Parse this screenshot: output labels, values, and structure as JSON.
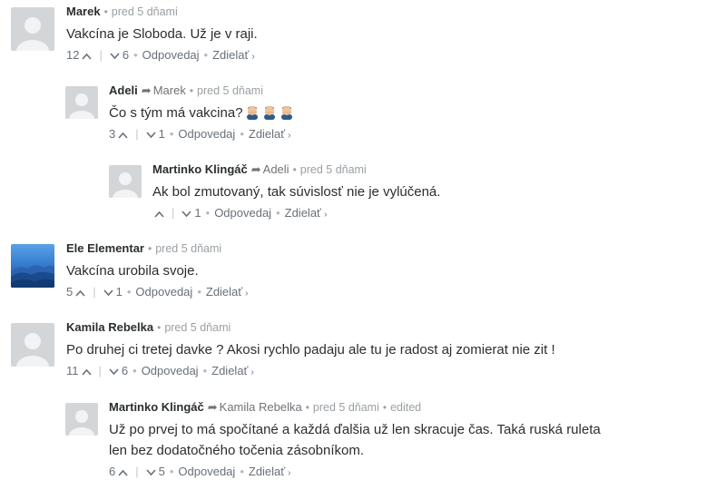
{
  "comments": [
    {
      "author": "Marek",
      "reply_to": "",
      "time": "pred 5 dňami",
      "edited": "",
      "text": "Vakcína je Sloboda. Už je v raji.",
      "upvotes": "12",
      "downvotes": "6",
      "reply_label": "Odpovedaj",
      "share_label": "Zdielať",
      "avatar": "default-avatar"
    },
    {
      "author": "Adeli",
      "reply_to": "Marek",
      "time": "pred 5 dňami",
      "edited": "",
      "text": "Čo s tým má vakcina?",
      "upvotes": "3",
      "downvotes": "1",
      "reply_label": "Odpovedaj",
      "share_label": "Zdielať",
      "avatar": "default-avatar",
      "emojis": [
        "man-facepalming-emoji",
        "man-facepalming-emoji",
        "man-facepalming-emoji"
      ]
    },
    {
      "author": "Martinko Klingáč",
      "reply_to": "Adeli",
      "time": "pred 5 dňami",
      "edited": "",
      "text": "Ak bol zmutovaný, tak súvislosť nie je vylúčená.",
      "upvotes": "",
      "downvotes": "1",
      "reply_label": "Odpovedaj",
      "share_label": "Zdielať",
      "avatar": "default-avatar"
    },
    {
      "author": "Ele Elementar",
      "reply_to": "",
      "time": "pred 5 dňami",
      "edited": "",
      "text": "Vakcína urobila svoje.",
      "upvotes": "5",
      "downvotes": "1",
      "reply_label": "Odpovedaj",
      "share_label": "Zdielať",
      "avatar": "landscape-avatar"
    },
    {
      "author": "Kamila Rebelka",
      "reply_to": "",
      "time": "pred 5 dňami",
      "edited": "",
      "text": "Po druhej ci tretej davke ? Akosi rychlo padaju ale tu je radost aj zomierat nie zit !",
      "upvotes": "11",
      "downvotes": "6",
      "reply_label": "Odpovedaj",
      "share_label": "Zdielať",
      "avatar": "default-avatar"
    },
    {
      "author": "Martinko Klingáč",
      "reply_to": "Kamila Rebelka",
      "time": "pred 5 dňami",
      "edited": "edited",
      "text": "Už po prvej to má spočítané a každá ďalšia už len skracuje čas. Taká ruská ruleta len bez dodatočného točenia zásobníkom.",
      "upvotes": "6",
      "downvotes": "5",
      "reply_label": "Odpovedaj",
      "share_label": "Zdielať",
      "avatar": "default-avatar"
    }
  ],
  "colors": {
    "author": "#2a2e2e",
    "meta": "#9aa0a4",
    "actions": "#687079",
    "avatar_placeholder": "#d3d6d9"
  }
}
